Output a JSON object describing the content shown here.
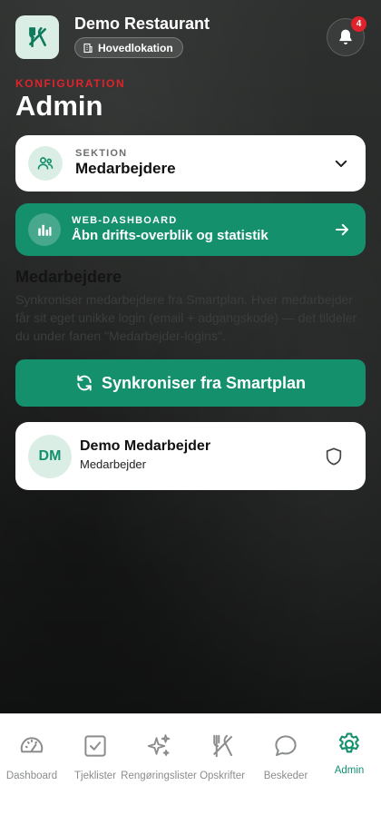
{
  "header": {
    "restaurant_name": "Demo Restaurant",
    "location": "Hovedlokation",
    "notification_count": "4"
  },
  "page": {
    "eyebrow": "KONFIGURATION",
    "title": "Admin"
  },
  "section_selector": {
    "eyebrow": "SEKTION",
    "value": "Medarbejdere"
  },
  "web_dashboard": {
    "eyebrow": "WEB-DASHBOARD",
    "title": "Åbn drifts-overblik og statistik"
  },
  "employees": {
    "heading": "Medarbejdere",
    "description": "Synkroniser medarbejdere fra Smartplan. Hver medarbejder får sit eget unikke login (email + adgangskode) — det tildeler du under fanen \"Medarbejder-logins\".",
    "sync_button": "Synkroniser fra Smartplan",
    "list": [
      {
        "initials": "DM",
        "name": "Demo Medarbejder",
        "role": "Medarbejder"
      }
    ]
  },
  "bottom_nav": {
    "items": [
      {
        "label": "Dashboard",
        "icon": "gauge-icon"
      },
      {
        "label": "Tjeklister",
        "icon": "checkbox-icon"
      },
      {
        "label": "Rengøringslister",
        "icon": "sparkles-icon"
      },
      {
        "label": "Opskrifter",
        "icon": "utensils-icon"
      },
      {
        "label": "Beskeder",
        "icon": "chat-bubble-icon"
      },
      {
        "label": "Admin",
        "icon": "gear-icon"
      }
    ],
    "active": "Admin"
  },
  "colors": {
    "accent": "#14906d",
    "accent_light": "#dbeee5",
    "alert": "#e0222c"
  }
}
